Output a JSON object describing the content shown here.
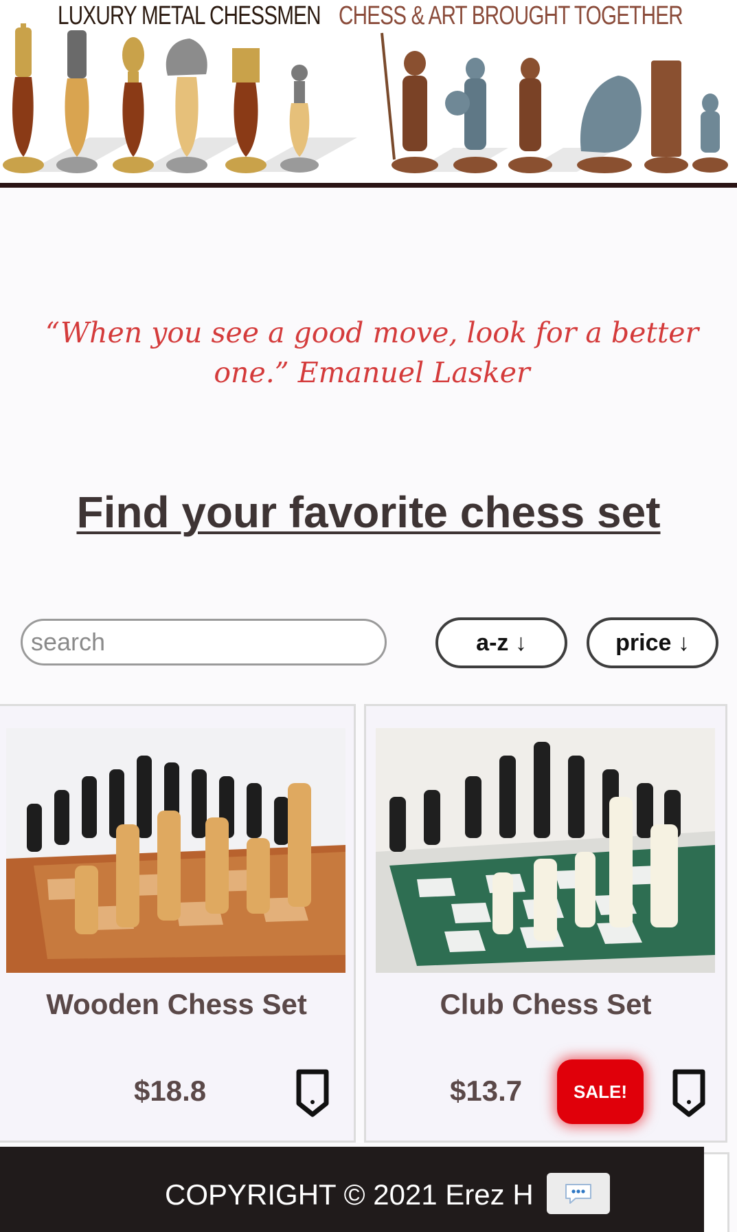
{
  "banner": {
    "title_left": "LUXURY METAL CHESSMEN",
    "title_right": "CHESS & ART BROUGHT TOGETHER"
  },
  "quote": {
    "text": "“When you see a good move, look for a better one.” Emanuel Lasker"
  },
  "heading": {
    "text": "Find your favorite chess set"
  },
  "controls": {
    "search_placeholder": "search",
    "search_value": "",
    "sort_az_label": "a-z ↓",
    "sort_price_label": "price ↓"
  },
  "products": [
    {
      "name": "Wooden Chess Set",
      "price": "$18.8",
      "icon": "tag-icon"
    },
    {
      "name": "Club Chess Set",
      "price": "$13.7",
      "badge": "SALE!",
      "icon": "tag-icon"
    }
  ],
  "footer": {
    "copyright": "COPYRIGHT © 2021 Erez H",
    "chat_icon": "chat-bubble-icon"
  },
  "colors": {
    "quote": "#d43b3b",
    "heading": "#3e3434",
    "sale": "#e0000a",
    "footer_bg": "#201b1b"
  }
}
